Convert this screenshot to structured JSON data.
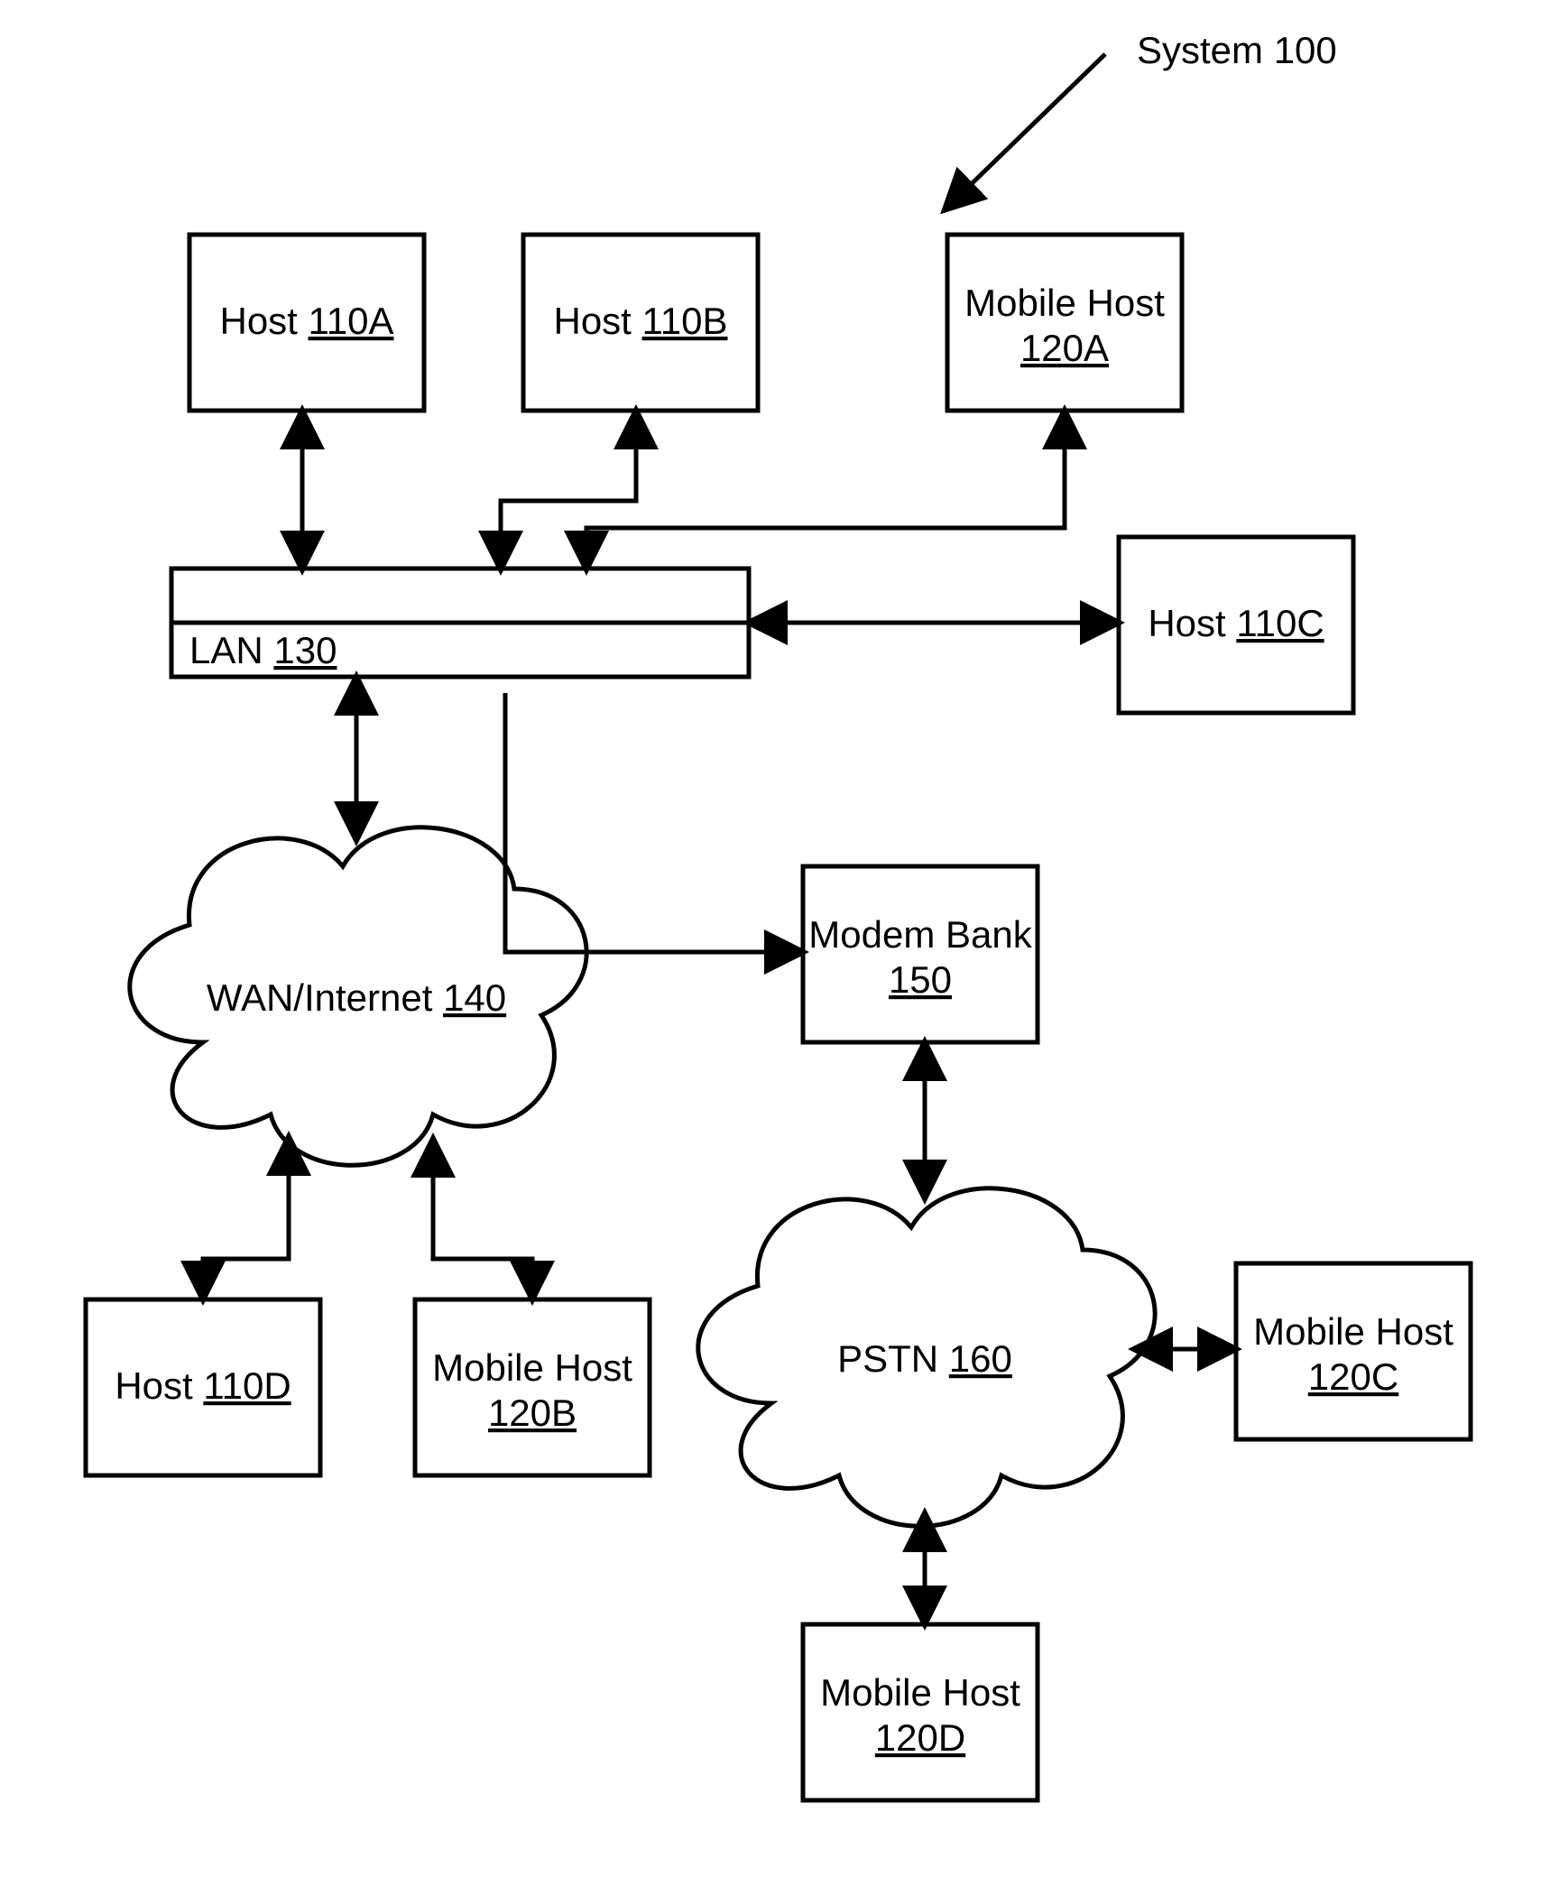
{
  "title": {
    "label": "System",
    "id": "100"
  },
  "nodes": {
    "host_a": {
      "label": "Host",
      "id": "110A"
    },
    "host_b": {
      "label": "Host",
      "id": "110B"
    },
    "host_c": {
      "label": "Host",
      "id": "110C"
    },
    "host_d": {
      "label": "Host",
      "id": "110D"
    },
    "mobile_host_a": {
      "label": "Mobile Host",
      "id": "120A"
    },
    "mobile_host_b": {
      "label": "Mobile Host",
      "id": "120B"
    },
    "mobile_host_c": {
      "label": "Mobile Host",
      "id": "120C"
    },
    "mobile_host_d": {
      "label": "Mobile Host",
      "id": "120D"
    },
    "lan": {
      "label": "LAN",
      "id": "130"
    },
    "wan": {
      "label": "WAN/Internet",
      "id": "140"
    },
    "modem_bank": {
      "label": "Modem Bank",
      "id": "150"
    },
    "pstn": {
      "label": "PSTN",
      "id": "160"
    }
  }
}
